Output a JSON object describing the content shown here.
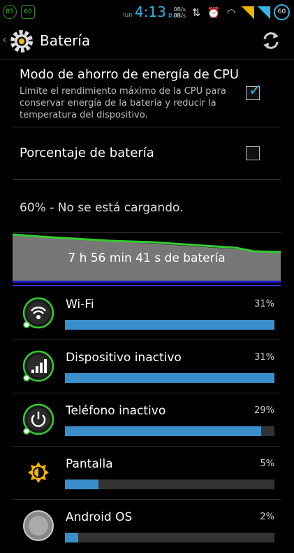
{
  "status_bar": {
    "left_icons": [
      "85",
      "60"
    ],
    "day": "lun",
    "time": "4:13",
    "ampm": "p.m.",
    "speed_up": "0B/s",
    "speed_down": "0B/s",
    "battery": "60"
  },
  "action_bar": {
    "title": "Batería",
    "logo_icon": "gear-icon",
    "refresh_icon": "refresh-icon"
  },
  "preferences": [
    {
      "title": "Modo de ahorro de energía de CPU",
      "summary": "Limite el rendimiento máximo de la CPU para conservar energía de la batería y reducir la temperatura del dispositivo.",
      "checked": true
    },
    {
      "title": "Porcentaje de batería",
      "summary": "",
      "checked": false
    }
  ],
  "battery_status": "60% - No se está cargando.",
  "battery_graph": {
    "label": "7 h 56 min 41 s de batería",
    "line_color": "#33cc33"
  },
  "usage": [
    {
      "name": "Wi-Fi",
      "percent_label": "31%",
      "percent": 31,
      "icon": "wifi-icon"
    },
    {
      "name": "Dispositivo inactivo",
      "percent_label": "31%",
      "percent": 31,
      "icon": "cell-signal-icon"
    },
    {
      "name": "Teléfono inactivo",
      "percent_label": "29%",
      "percent": 29,
      "icon": "power-icon"
    },
    {
      "name": "Pantalla",
      "percent_label": "5%",
      "percent": 5,
      "icon": "brightness-icon"
    },
    {
      "name": "Android OS",
      "percent_label": "2%",
      "percent": 2,
      "icon": "android-icon"
    }
  ],
  "colors": {
    "accent": "#33b5e5",
    "bar_fill": "#3a8fcb",
    "green": "#33cc33"
  }
}
